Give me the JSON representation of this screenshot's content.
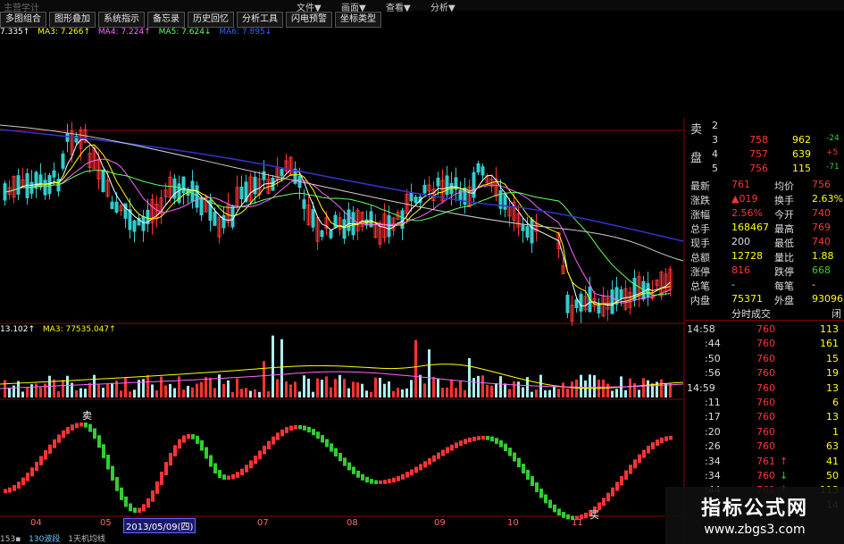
{
  "menubar": {
    "left_label": "主营学计",
    "items": [
      "文件▼",
      "画面▼",
      "查看▼",
      "分析▼"
    ]
  },
  "toolbar": [
    "多图组合",
    "图形叠加",
    "系统指示",
    "备忘录",
    "历史回忆",
    "分析工具",
    "闪电预警",
    "坐标类型"
  ],
  "ma_legend": [
    {
      "text": "7.335↑",
      "color": "#ffffff"
    },
    {
      "text": "MA3: 7.266↑",
      "color": "#ffff00"
    },
    {
      "text": "MA4: 7.224↑",
      "color": "#ff66ff"
    },
    {
      "text": "MA5: 7.624↓",
      "color": "#66ff66"
    },
    {
      "text": "MA6: 7.895↓",
      "color": "#3366ff"
    }
  ],
  "volume_legend": [
    {
      "text": "13.102↑",
      "color": "#ffffff"
    },
    {
      "text": "MA3: 77535.047↑",
      "color": "#ffff00"
    }
  ],
  "chart_labels": {
    "sell_marker": "卖",
    "buy_marker": "买"
  },
  "date_axis": {
    "labels": [
      "04",
      "05",
      "07",
      "08",
      "09",
      "10",
      "11"
    ],
    "cursor_date": "2013/05/09(四)"
  },
  "bottom_tabs": [
    "153▪",
    "130波段",
    "1天机均线"
  ],
  "order_book": {
    "side_label_1": "卖",
    "side_label_2": "盘",
    "rows": [
      {
        "level": "2",
        "price": "",
        "vol": "",
        "change": ""
      },
      {
        "level": "3",
        "price": "758",
        "vol": "962",
        "change": "-24"
      },
      {
        "level": "4",
        "price": "757",
        "vol": "639",
        "change": "+5"
      },
      {
        "level": "5",
        "price": "756",
        "vol": "115",
        "change": "-71"
      }
    ]
  },
  "quote": [
    {
      "l1": "最新",
      "v1": "761",
      "l2": "均价",
      "v2": "756"
    },
    {
      "l1": "涨跌",
      "v1": "▲019",
      "l2": "换手",
      "v2": "2.63%"
    },
    {
      "l1": "涨幅",
      "v1": "2.56%",
      "l2": "今开",
      "v2": "740"
    },
    {
      "l1": "总手",
      "v1": "168467",
      "l2": "最高",
      "v2": "769"
    },
    {
      "l1": "现手",
      "v1": "200",
      "l2": "最低",
      "v2": "740"
    },
    {
      "l1": "总额",
      "v1": "12728",
      "l2": "量比",
      "v2": "1.88"
    },
    {
      "l1": "涨停",
      "v1": "816",
      "l2": "跌停",
      "v2": "668"
    },
    {
      "l1": "总笔",
      "v1": "-",
      "l2": "每笔",
      "v2": "-"
    },
    {
      "l1": "内盘",
      "v1": "75371",
      "l2": "外盘",
      "v2": "93096"
    }
  ],
  "ticks_header": {
    "title": "分时成交",
    "right": "闭"
  },
  "ticks": [
    {
      "time": "14:58",
      "price": "760",
      "arrow": "",
      "vol": "113"
    },
    {
      "time": ":44",
      "price": "760",
      "arrow": "",
      "vol": "161"
    },
    {
      "time": ":50",
      "price": "760",
      "arrow": "",
      "vol": "15"
    },
    {
      "time": ":56",
      "price": "760",
      "arrow": "",
      "vol": "19"
    },
    {
      "time": "14:59",
      "price": "760",
      "arrow": "",
      "vol": "13"
    },
    {
      "time": ":11",
      "price": "760",
      "arrow": "",
      "vol": "6"
    },
    {
      "time": ":17",
      "price": "760",
      "arrow": "",
      "vol": "13"
    },
    {
      "time": ":20",
      "price": "760",
      "arrow": "",
      "vol": "1"
    },
    {
      "time": ":26",
      "price": "760",
      "arrow": "",
      "vol": "63"
    },
    {
      "time": ":34",
      "price": "761",
      "arrow": "↑",
      "vol": "41"
    },
    {
      "time": ":34",
      "price": "760",
      "arrow": "↓",
      "vol": "50"
    },
    {
      "time": ":44",
      "price": "761",
      "arrow": "↑",
      "vol": "113"
    },
    {
      "time": ":50",
      "price": "761",
      "arrow": "",
      "vol": "14"
    }
  ],
  "watermark": {
    "title": "指标公式网",
    "url": "www.zbgs3.com"
  },
  "colors": {
    "up": "#ff3333",
    "down": "#33cccc",
    "osc_up": "#ff3333",
    "osc_down": "#33cc33",
    "grid": "#8b0000"
  }
}
